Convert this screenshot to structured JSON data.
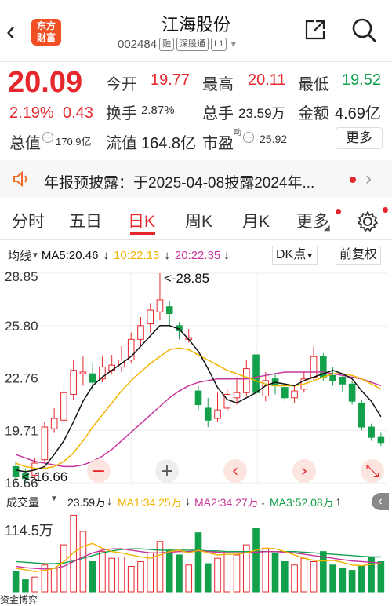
{
  "header": {
    "back_label": "‹",
    "logo_line1": "东方",
    "logo_line2": "财富",
    "stock_name": "江海股份",
    "stock_code": "002484",
    "tags": [
      "融",
      "深股通",
      "L1"
    ]
  },
  "quote": {
    "price": "20.09",
    "change_pct": "2.19%",
    "change_abs": "0.43",
    "open_label": "今开",
    "open_value": "19.77",
    "high_label": "最高",
    "high_value": "20.11",
    "low_label": "最低",
    "low_value": "19.52",
    "turnover_label": "换手",
    "turnover_value": "2.87%",
    "total_hands_label": "总手",
    "total_hands_value": "23.59万",
    "amount_label": "金额",
    "amount_value": "4.69亿",
    "total_value_label": "总值",
    "total_value_value": "170.9亿",
    "float_value_label": "流值",
    "float_value_value": "164.8亿",
    "pe_label": "市盈",
    "pe_sup": "动",
    "pe_value": "25.92",
    "more_label": "更多"
  },
  "notice": {
    "text": "年报预披露：于2025-04-08披露2024年..."
  },
  "tabs": [
    {
      "label": "分时"
    },
    {
      "label": "五日"
    },
    {
      "label": "日K"
    },
    {
      "label": "周K"
    },
    {
      "label": "月K"
    },
    {
      "label": "更多"
    }
  ],
  "chart_toolbar": {
    "ma_selector": "均线",
    "ma5": "MA5:20.46",
    "ma10": "10:22.13",
    "ma20": "20:22.35",
    "dk_label": "DK点",
    "adjust_label": "前复权"
  },
  "kline_labels": {
    "y_ticks": [
      "28.85",
      "25.80",
      "22.76",
      "19.71",
      "16.66"
    ],
    "high_marker": "<-28.85",
    "low_marker": "<-16.66",
    "zoom_out": "−",
    "zoom_in": "+"
  },
  "volume_bar": {
    "selector": "成交量",
    "vol": "23.59万",
    "ma1": "MA1:34.25万",
    "ma2": "MA2:34.27万",
    "ma3": "MA3:52.08万",
    "y_tick": "114.5万"
  },
  "colors": {
    "up": "#e6272d",
    "down": "#12a04a",
    "ma5": "#111111",
    "ma10": "#f0b400",
    "ma20": "#c8359a",
    "accent": "#e6272d"
  },
  "chart_data": {
    "type": "candlestick",
    "y_range": [
      16.66,
      28.85
    ],
    "candles": [
      {
        "o": 17.6,
        "c": 17.0,
        "h": 17.9,
        "l": 16.66
      },
      {
        "o": 17.2,
        "c": 16.9,
        "h": 17.5,
        "l": 16.7
      },
      {
        "o": 17.1,
        "c": 17.8,
        "h": 18.1,
        "l": 16.9
      },
      {
        "o": 18.0,
        "c": 19.9,
        "h": 20.2,
        "l": 17.9
      },
      {
        "o": 19.8,
        "c": 20.4,
        "h": 21.0,
        "l": 19.6
      },
      {
        "o": 20.3,
        "c": 21.9,
        "h": 22.3,
        "l": 20.1
      },
      {
        "o": 21.8,
        "c": 23.2,
        "h": 23.8,
        "l": 21.5
      },
      {
        "o": 23.0,
        "c": 23.1,
        "h": 24.0,
        "l": 22.3
      },
      {
        "o": 23.0,
        "c": 22.5,
        "h": 23.6,
        "l": 22.0
      },
      {
        "o": 22.7,
        "c": 23.4,
        "h": 24.0,
        "l": 22.5
      },
      {
        "o": 23.2,
        "c": 23.5,
        "h": 24.1,
        "l": 23.0
      },
      {
        "o": 23.4,
        "c": 23.8,
        "h": 24.6,
        "l": 23.1
      },
      {
        "o": 23.8,
        "c": 25.0,
        "h": 25.4,
        "l": 23.6
      },
      {
        "o": 25.0,
        "c": 25.8,
        "h": 26.3,
        "l": 24.6
      },
      {
        "o": 25.9,
        "c": 26.7,
        "h": 27.1,
        "l": 25.4
      },
      {
        "o": 26.6,
        "c": 27.3,
        "h": 28.85,
        "l": 26.1
      },
      {
        "o": 26.9,
        "c": 26.5,
        "h": 27.2,
        "l": 25.8
      },
      {
        "o": 25.8,
        "c": 25.5,
        "h": 26.0,
        "l": 25.0
      },
      {
        "o": 25.0,
        "c": 25.1,
        "h": 25.6,
        "l": 24.8
      },
      {
        "o": 22.0,
        "c": 21.2,
        "h": 22.3,
        "l": 20.9
      },
      {
        "o": 21.0,
        "c": 20.3,
        "h": 21.6,
        "l": 19.9
      },
      {
        "o": 20.4,
        "c": 20.9,
        "h": 21.9,
        "l": 20.2
      },
      {
        "o": 21.0,
        "c": 21.8,
        "h": 22.1,
        "l": 20.8
      },
      {
        "o": 21.6,
        "c": 21.9,
        "h": 22.8,
        "l": 21.2
      },
      {
        "o": 21.9,
        "c": 23.3,
        "h": 23.8,
        "l": 21.7
      },
      {
        "o": 24.1,
        "c": 21.9,
        "h": 24.6,
        "l": 21.6
      },
      {
        "o": 21.7,
        "c": 22.6,
        "h": 23.1,
        "l": 21.4
      },
      {
        "o": 22.7,
        "c": 22.3,
        "h": 23.0,
        "l": 21.8
      },
      {
        "o": 22.2,
        "c": 21.6,
        "h": 22.4,
        "l": 21.4
      },
      {
        "o": 21.6,
        "c": 22.0,
        "h": 22.3,
        "l": 21.3
      },
      {
        "o": 22.1,
        "c": 22.7,
        "h": 23.1,
        "l": 21.9
      },
      {
        "o": 22.8,
        "c": 24.0,
        "h": 24.6,
        "l": 22.6
      },
      {
        "o": 24.0,
        "c": 22.8,
        "h": 24.2,
        "l": 22.6
      },
      {
        "o": 22.9,
        "c": 22.6,
        "h": 23.4,
        "l": 22.3
      },
      {
        "o": 22.8,
        "c": 22.4,
        "h": 23.0,
        "l": 21.9
      },
      {
        "o": 22.4,
        "c": 21.4,
        "h": 22.6,
        "l": 21.2
      },
      {
        "o": 21.3,
        "c": 19.9,
        "h": 21.5,
        "l": 19.7
      },
      {
        "o": 19.9,
        "c": 19.3,
        "h": 20.1,
        "l": 19.1
      },
      {
        "o": 19.3,
        "c": 19.0,
        "h": 19.6,
        "l": 18.8
      }
    ],
    "ma5": [
      17.4,
      17.3,
      17.4,
      17.6,
      18.3,
      19.1,
      20.2,
      21.4,
      22.3,
      22.8,
      23.2,
      23.6,
      24.0,
      24.6,
      25.2,
      25.8,
      25.8,
      25.6,
      25.0,
      24.3,
      23.3,
      22.2,
      21.5,
      21.3,
      21.6,
      21.9,
      22.3,
      22.5,
      22.4,
      22.3,
      22.6,
      22.8,
      23.0,
      23.2,
      23.0,
      22.7,
      22.0,
      21.4,
      20.5
    ],
    "ma10": [
      17.8,
      17.6,
      17.5,
      17.5,
      17.6,
      17.9,
      18.4,
      19.1,
      19.9,
      20.6,
      21.3,
      22.0,
      22.6,
      23.1,
      23.6,
      24.0,
      24.4,
      24.5,
      24.4,
      24.1,
      23.8,
      23.5,
      23.2,
      23.0,
      22.8,
      22.6,
      22.4,
      22.3,
      22.3,
      22.3,
      22.4,
      22.6,
      22.8,
      23.0,
      23.0,
      22.9,
      22.7,
      22.4,
      22.1
    ],
    "ma20": [
      18.3,
      18.1,
      17.9,
      17.8,
      17.7,
      17.6,
      17.6,
      17.7,
      17.9,
      18.2,
      18.6,
      19.1,
      19.6,
      20.1,
      20.6,
      21.1,
      21.6,
      22.0,
      22.3,
      22.5,
      22.6,
      22.7,
      22.7,
      22.7,
      22.7,
      22.8,
      22.9,
      23.0,
      23.1,
      23.1,
      23.1,
      23.1,
      23.1,
      23.0,
      22.9,
      22.8,
      22.7,
      22.5,
      22.3
    ],
    "volume_range": [
      0,
      114.5
    ],
    "volumes": [
      30,
      18,
      22,
      40,
      35,
      70,
      114,
      90,
      45,
      60,
      50,
      52,
      38,
      45,
      58,
      75,
      62,
      55,
      40,
      88,
      42,
      50,
      60,
      55,
      70,
      95,
      65,
      58,
      45,
      40,
      50,
      45,
      60,
      40,
      35,
      32,
      38,
      52,
      45
    ],
    "vol_ma1": [
      35,
      33,
      30,
      32,
      35,
      45,
      58,
      68,
      72,
      65,
      60,
      58,
      55,
      52,
      50,
      55,
      60,
      62,
      58,
      62,
      58,
      55,
      56,
      56,
      58,
      62,
      65,
      64,
      60,
      55,
      50,
      47,
      46,
      47,
      44,
      40,
      39,
      41,
      42
    ],
    "vol_ma2": [
      38,
      36,
      35,
      34,
      35,
      38,
      45,
      52,
      58,
      62,
      64,
      64,
      62,
      60,
      58,
      58,
      59,
      60,
      60,
      61,
      60,
      59,
      58,
      58,
      58,
      59,
      60,
      60,
      59,
      58,
      56,
      54,
      52,
      50,
      48,
      46,
      45,
      44,
      43
    ],
    "vol_ma3": [
      45,
      44,
      43,
      42,
      42,
      43,
      46,
      50,
      54,
      58,
      61,
      63,
      64,
      64,
      63,
      62,
      62,
      62,
      62,
      62,
      61,
      61,
      60,
      60,
      60,
      60,
      60,
      60,
      60,
      60,
      59,
      58,
      57,
      56,
      55,
      54,
      53,
      52,
      52
    ]
  },
  "bottom": {
    "text": "资金博弈"
  }
}
